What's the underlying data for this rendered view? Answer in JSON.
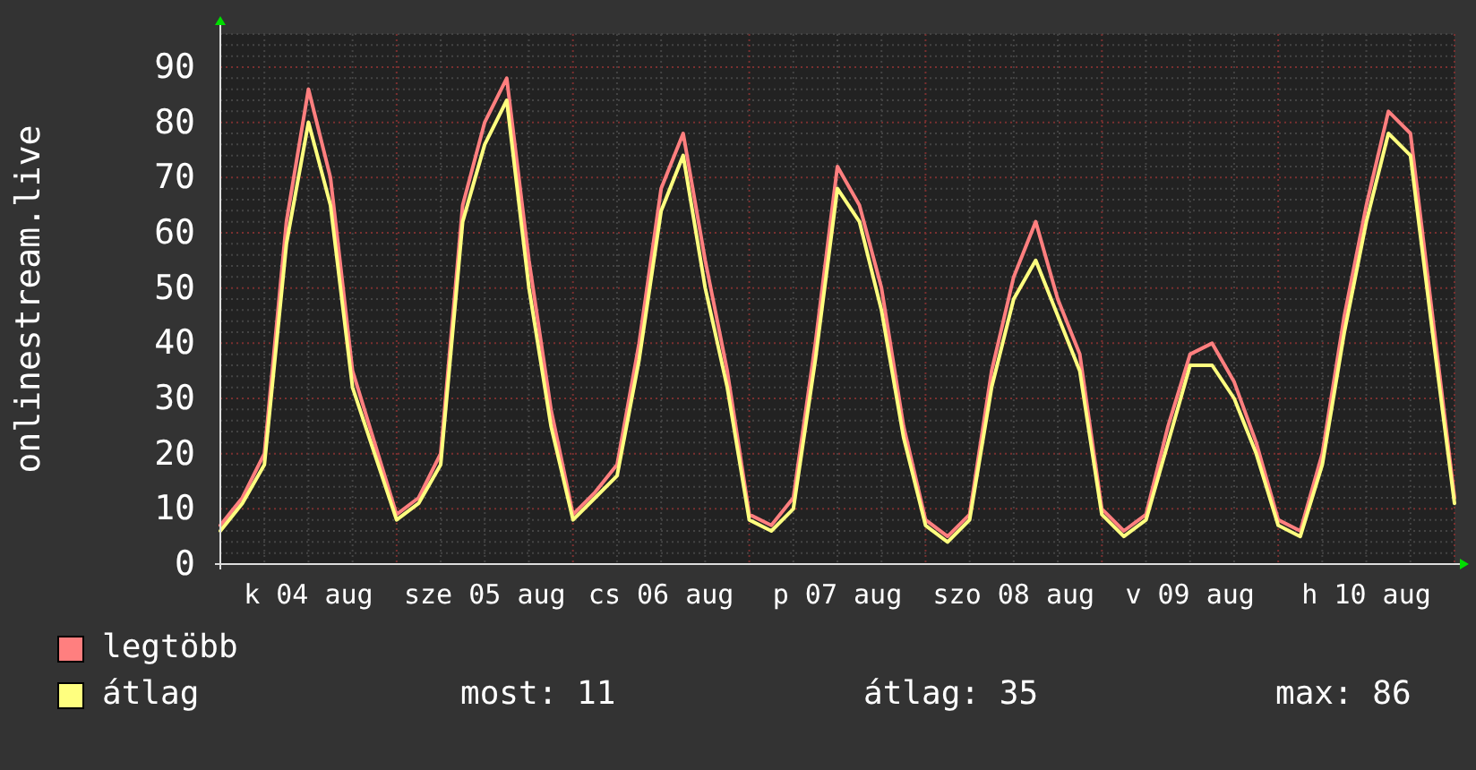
{
  "chart": {
    "chart_data": {
      "type": "line",
      "ylabel": "onlinestream.live",
      "categories": [
        null,
        null,
        null,
        null,
        "k 04 aug",
        null,
        null,
        null,
        null,
        null,
        null,
        null,
        "sze 05 aug",
        null,
        null,
        null,
        null,
        null,
        null,
        null,
        "cs 06 aug",
        null,
        null,
        null,
        null,
        null,
        null,
        null,
        "p 07 aug",
        null,
        null,
        null,
        null,
        null,
        null,
        null,
        "szo 08 aug",
        null,
        null,
        null,
        null,
        null,
        null,
        null,
        "v 09 aug",
        null,
        null,
        null,
        null,
        null,
        null,
        null,
        "h 10 aug",
        null,
        null,
        null,
        null
      ],
      "ylim": [
        0,
        96
      ],
      "grid": true,
      "yticks": [
        0,
        10,
        20,
        30,
        40,
        50,
        60,
        70,
        80,
        90
      ],
      "series": [
        {
          "name": "legtöbb",
          "color": "#ff7f7f",
          "values": [
            7,
            12,
            20,
            62,
            86,
            70,
            35,
            22,
            9,
            12,
            20,
            65,
            80,
            88,
            55,
            28,
            9,
            13,
            18,
            40,
            68,
            78,
            55,
            35,
            9,
            7,
            12,
            40,
            72,
            65,
            50,
            25,
            8,
            5,
            9,
            35,
            52,
            62,
            48,
            38,
            10,
            6,
            9,
            25,
            38,
            40,
            33,
            22,
            8,
            6,
            20,
            45,
            65,
            82,
            78,
            45,
            12
          ]
        },
        {
          "name": "átlag",
          "color": "#ffff7f",
          "values": [
            6,
            11,
            18,
            58,
            80,
            65,
            32,
            20,
            8,
            11,
            18,
            62,
            76,
            84,
            50,
            25,
            8,
            12,
            16,
            37,
            64,
            74,
            50,
            32,
            8,
            6,
            10,
            37,
            68,
            62,
            46,
            23,
            7,
            4,
            8,
            32,
            48,
            55,
            45,
            35,
            9,
            5,
            8,
            22,
            36,
            36,
            30,
            20,
            7,
            5,
            18,
            42,
            62,
            78,
            74,
            42,
            11
          ]
        }
      ]
    }
  },
  "stats": [
    "most: 11",
    "átlag: 35",
    "max: 86"
  ]
}
